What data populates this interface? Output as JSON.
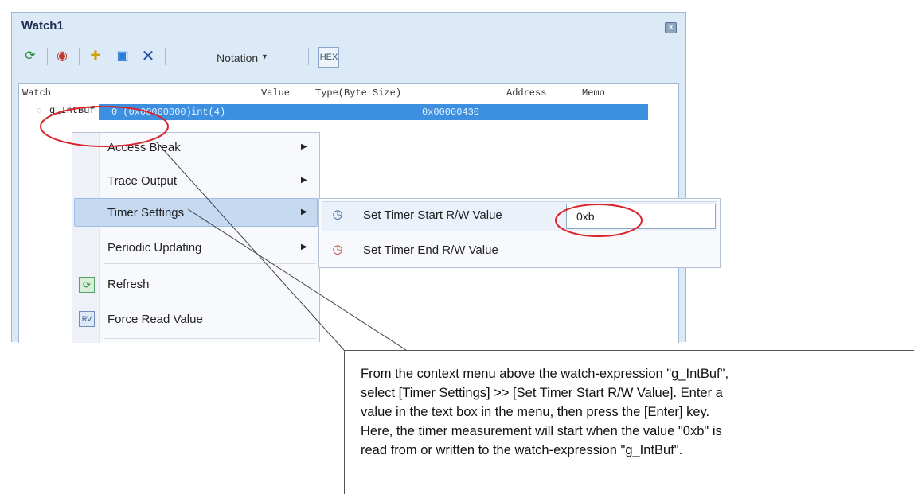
{
  "window": {
    "title": "Watch1",
    "close_icon": "close-icon"
  },
  "toolbar": {
    "icons": [
      "refresh-icon",
      "palette-icon",
      "add-watch-icon",
      "new-category-icon",
      "delete-icon"
    ],
    "notation_label": "Notation",
    "notation_dropdown_icon": "chevron-down-icon",
    "view_toggle_label": "HEX"
  },
  "table": {
    "columns": [
      "Watch",
      "Value",
      "Type(Byte Size)",
      "Address",
      "Memo"
    ],
    "row": {
      "name": "g_IntBuf",
      "value": "0 (0x00000000)",
      "type": "int(4)",
      "address": "0x00000430",
      "memo": ""
    }
  },
  "context_menu": {
    "items": [
      {
        "label": "Access Break",
        "has_submenu": true
      },
      {
        "label": "Trace Output",
        "has_submenu": true
      },
      {
        "label": "Timer Settings",
        "has_submenu": true
      },
      {
        "label": "Periodic Updating",
        "has_submenu": true
      },
      {
        "label": "Refresh",
        "icon": "refresh-icon"
      },
      {
        "label": "Force Read Value",
        "icon": "force-read-icon"
      }
    ],
    "selected": "Timer Settings"
  },
  "submenu": {
    "items": [
      {
        "label": "Set Timer Start R/W Value",
        "icon": "timer-start-icon",
        "input_value": "0xb"
      },
      {
        "label": "Set Timer End R/W Value",
        "icon": "timer-end-icon"
      }
    ]
  },
  "callout": {
    "lines": [
      "From the context menu above the watch-expression \"g_IntBuf\",",
      "select [Timer Settings] >> [Set Timer Start R/W Value]. Enter a",
      "value in the text box in the menu, then press the [Enter] key.",
      "Here, the timer measurement will start when the value \"0xb\" is",
      "read from or written to the watch-expression \"g_IntBuf\"."
    ]
  },
  "colors": {
    "highlight_circle": "#d9262c",
    "selected_row": "#3d8fe0",
    "window_bg": "#dce9f7"
  }
}
